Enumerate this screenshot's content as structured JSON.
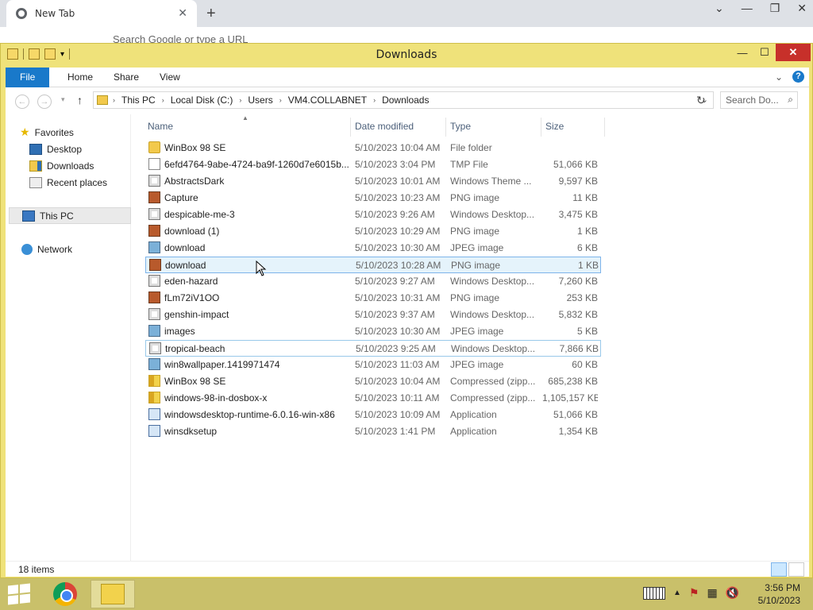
{
  "browser": {
    "tab_title": "New Tab",
    "tab_close": "✕",
    "new_tab": "+",
    "omnibox_placeholder": "Search Google or type a URL"
  },
  "explorer": {
    "title": "Downloads",
    "window_controls": {
      "minimize": "—",
      "maximize": "☐",
      "close": "✕"
    },
    "ribbon_tabs": [
      "File",
      "Home",
      "Share",
      "View"
    ],
    "help": "?",
    "breadcrumb": [
      "This PC",
      "Local Disk (C:)",
      "Users",
      "VM4.COLLABNET",
      "Downloads"
    ],
    "search_placeholder": "Search Do...",
    "nav": {
      "favorites": "Favorites",
      "desktop": "Desktop",
      "downloads": "Downloads",
      "recent": "Recent places",
      "this_pc": "This PC",
      "network": "Network"
    },
    "columns": [
      "Name",
      "Date modified",
      "Type",
      "Size"
    ],
    "files": [
      {
        "name": "WinBox 98 SE",
        "date": "5/10/2023 10:04 AM",
        "type": "File folder",
        "size": "",
        "icon": "folder-icon"
      },
      {
        "name": "6efd4764-9abe-4724-ba9f-1260d7e6015b....",
        "date": "5/10/2023 3:04 PM",
        "type": "TMP File",
        "size": "51,066 KB",
        "icon": "tmp-file-icon"
      },
      {
        "name": "AbstractsDark",
        "date": "5/10/2023 10:01 AM",
        "type": "Windows Theme ...",
        "size": "9,597 KB",
        "icon": "theme-file-icon"
      },
      {
        "name": "Capture",
        "date": "5/10/2023 10:23 AM",
        "type": "PNG image",
        "size": "11 KB",
        "icon": "png-image-icon"
      },
      {
        "name": "despicable-me-3",
        "date": "5/10/2023 9:26 AM",
        "type": "Windows Desktop...",
        "size": "3,475 KB",
        "icon": "theme-file-icon"
      },
      {
        "name": "download (1)",
        "date": "5/10/2023 10:29 AM",
        "type": "PNG image",
        "size": "1 KB",
        "icon": "png-image-icon"
      },
      {
        "name": "download",
        "date": "5/10/2023 10:30 AM",
        "type": "JPEG image",
        "size": "6 KB",
        "icon": "jpeg-image-icon"
      },
      {
        "name": "download",
        "date": "5/10/2023 10:28 AM",
        "type": "PNG image",
        "size": "1 KB",
        "icon": "png-image-icon"
      },
      {
        "name": "eden-hazard",
        "date": "5/10/2023 9:27 AM",
        "type": "Windows Desktop...",
        "size": "7,260 KB",
        "icon": "theme-file-icon"
      },
      {
        "name": "fLm72iV1OO",
        "date": "5/10/2023 10:31 AM",
        "type": "PNG image",
        "size": "253 KB",
        "icon": "png-image-icon"
      },
      {
        "name": "genshin-impact",
        "date": "5/10/2023 9:37 AM",
        "type": "Windows Desktop...",
        "size": "5,832 KB",
        "icon": "theme-file-icon"
      },
      {
        "name": "images",
        "date": "5/10/2023 10:30 AM",
        "type": "JPEG image",
        "size": "5 KB",
        "icon": "jpeg-image-icon"
      },
      {
        "name": "tropical-beach",
        "date": "5/10/2023 9:25 AM",
        "type": "Windows Desktop...",
        "size": "7,866 KB",
        "icon": "theme-file-icon"
      },
      {
        "name": "win8wallpaper.1419971474",
        "date": "5/10/2023 11:03 AM",
        "type": "JPEG image",
        "size": "60 KB",
        "icon": "jpeg-image-icon"
      },
      {
        "name": "WinBox 98 SE",
        "date": "5/10/2023 10:04 AM",
        "type": "Compressed (zipp...",
        "size": "685,238 KB",
        "icon": "zip-file-icon"
      },
      {
        "name": "windows-98-in-dosbox-x",
        "date": "5/10/2023 10:11 AM",
        "type": "Compressed (zipp...",
        "size": "1,105,157 KB",
        "icon": "zip-file-icon"
      },
      {
        "name": "windowsdesktop-runtime-6.0.16-win-x86",
        "date": "5/10/2023 10:09 AM",
        "type": "Application",
        "size": "51,066 KB",
        "icon": "application-icon"
      },
      {
        "name": "winsdksetup",
        "date": "5/10/2023 1:41 PM",
        "type": "Application",
        "size": "1,354 KB",
        "icon": "application-icon"
      }
    ],
    "status_count": "18 items"
  },
  "taskbar": {
    "time": "3:56 PM",
    "date": "5/10/2023"
  }
}
